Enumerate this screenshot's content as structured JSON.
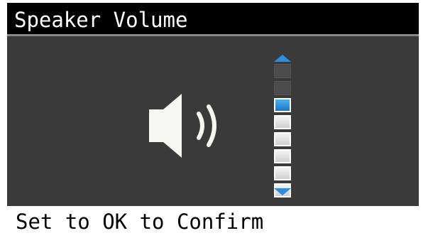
{
  "header": {
    "title": "Speaker Volume"
  },
  "icons": {
    "speaker": "speaker-volume-icon",
    "increase": "volume-up-arrow-icon",
    "decrease": "volume-down-arrow-icon"
  },
  "volume": {
    "total_levels": 8,
    "current_level": 6,
    "colors": {
      "active": "#1a78c9",
      "filled": "#e0e0e0",
      "empty": "#4c4c4c",
      "arrows": "#2a8fe0"
    }
  },
  "footer": {
    "instruction": "Set to OK to Confirm"
  }
}
